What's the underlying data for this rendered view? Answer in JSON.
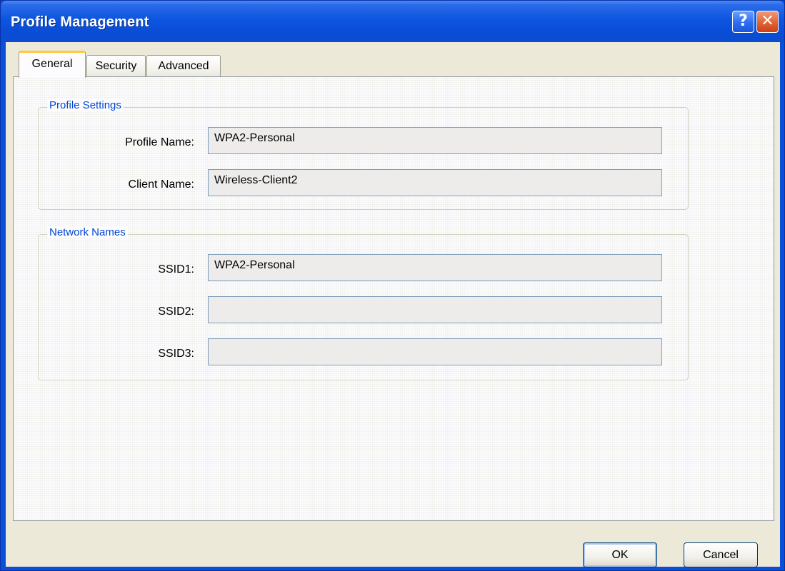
{
  "window": {
    "title": "Profile Management",
    "help_glyph": "?",
    "close_glyph": "✕"
  },
  "tabs": [
    {
      "label": "General",
      "active": true
    },
    {
      "label": "Security",
      "active": false
    },
    {
      "label": "Advanced",
      "active": false
    }
  ],
  "profile_settings": {
    "legend": "Profile Settings",
    "profile_name_label": "Profile Name:",
    "profile_name_value": "WPA2-Personal",
    "client_name_label": "Client Name:",
    "client_name_value": "Wireless-Client2"
  },
  "network_names": {
    "legend": "Network Names",
    "ssid1_label": "SSID1:",
    "ssid1_value": "WPA2-Personal",
    "ssid2_label": "SSID2:",
    "ssid2_value": "",
    "ssid3_label": "SSID3:",
    "ssid3_value": ""
  },
  "buttons": {
    "ok": "OK",
    "cancel": "Cancel"
  },
  "colors": {
    "titlebar": "#0a4fd8",
    "group_legend": "#0046d5",
    "active_tab_accent": "#ffc83c"
  }
}
